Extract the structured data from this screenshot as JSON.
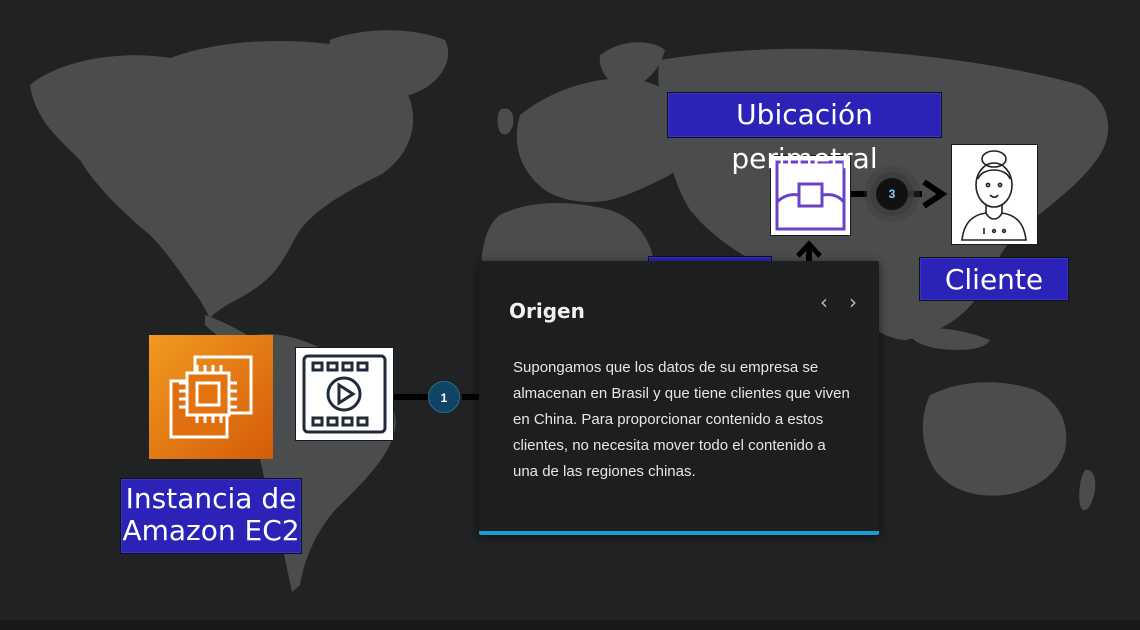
{
  "labels": {
    "edge_location": "Ubicación perimetral",
    "client": "Cliente",
    "ec2_instance": "Instancia de Amazon EC2"
  },
  "steps": {
    "step1": "1",
    "step3": "3"
  },
  "card": {
    "title": "Origen",
    "prev": "‹",
    "next": "›",
    "body": "Supongamos que los datos de su empresa se almacenan en Brasil y que tiene clientes que viven en China. Para proporcionar contenido a estos clientes, no necesita mover todo el contenido a una de las regiones chinas."
  },
  "colors": {
    "background": "#202224",
    "land": "#4a4c4e",
    "label_bg": "#2b23b8",
    "ec2_orange": "#e3730f",
    "accent_bar": "#1a9bd7",
    "edge_purple": "#6a42c6"
  },
  "icons": {
    "ec2": "chip-icon",
    "video": "video-file-icon",
    "edge": "edge-location-icon",
    "client": "person-icon"
  }
}
